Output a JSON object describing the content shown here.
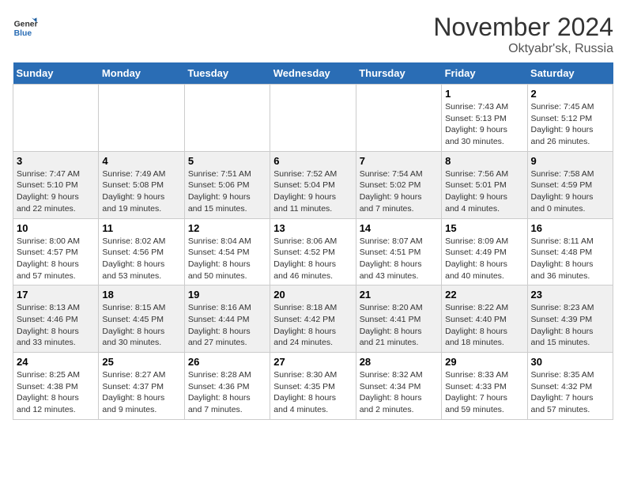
{
  "header": {
    "logo_general": "General",
    "logo_blue": "Blue",
    "month_title": "November 2024",
    "location": "Oktyabr'sk, Russia"
  },
  "days_of_week": [
    "Sunday",
    "Monday",
    "Tuesday",
    "Wednesday",
    "Thursday",
    "Friday",
    "Saturday"
  ],
  "weeks": [
    [
      {
        "day": "",
        "detail": ""
      },
      {
        "day": "",
        "detail": ""
      },
      {
        "day": "",
        "detail": ""
      },
      {
        "day": "",
        "detail": ""
      },
      {
        "day": "",
        "detail": ""
      },
      {
        "day": "1",
        "detail": "Sunrise: 7:43 AM\nSunset: 5:13 PM\nDaylight: 9 hours\nand 30 minutes."
      },
      {
        "day": "2",
        "detail": "Sunrise: 7:45 AM\nSunset: 5:12 PM\nDaylight: 9 hours\nand 26 minutes."
      }
    ],
    [
      {
        "day": "3",
        "detail": "Sunrise: 7:47 AM\nSunset: 5:10 PM\nDaylight: 9 hours\nand 22 minutes."
      },
      {
        "day": "4",
        "detail": "Sunrise: 7:49 AM\nSunset: 5:08 PM\nDaylight: 9 hours\nand 19 minutes."
      },
      {
        "day": "5",
        "detail": "Sunrise: 7:51 AM\nSunset: 5:06 PM\nDaylight: 9 hours\nand 15 minutes."
      },
      {
        "day": "6",
        "detail": "Sunrise: 7:52 AM\nSunset: 5:04 PM\nDaylight: 9 hours\nand 11 minutes."
      },
      {
        "day": "7",
        "detail": "Sunrise: 7:54 AM\nSunset: 5:02 PM\nDaylight: 9 hours\nand 7 minutes."
      },
      {
        "day": "8",
        "detail": "Sunrise: 7:56 AM\nSunset: 5:01 PM\nDaylight: 9 hours\nand 4 minutes."
      },
      {
        "day": "9",
        "detail": "Sunrise: 7:58 AM\nSunset: 4:59 PM\nDaylight: 9 hours\nand 0 minutes."
      }
    ],
    [
      {
        "day": "10",
        "detail": "Sunrise: 8:00 AM\nSunset: 4:57 PM\nDaylight: 8 hours\nand 57 minutes."
      },
      {
        "day": "11",
        "detail": "Sunrise: 8:02 AM\nSunset: 4:56 PM\nDaylight: 8 hours\nand 53 minutes."
      },
      {
        "day": "12",
        "detail": "Sunrise: 8:04 AM\nSunset: 4:54 PM\nDaylight: 8 hours\nand 50 minutes."
      },
      {
        "day": "13",
        "detail": "Sunrise: 8:06 AM\nSunset: 4:52 PM\nDaylight: 8 hours\nand 46 minutes."
      },
      {
        "day": "14",
        "detail": "Sunrise: 8:07 AM\nSunset: 4:51 PM\nDaylight: 8 hours\nand 43 minutes."
      },
      {
        "day": "15",
        "detail": "Sunrise: 8:09 AM\nSunset: 4:49 PM\nDaylight: 8 hours\nand 40 minutes."
      },
      {
        "day": "16",
        "detail": "Sunrise: 8:11 AM\nSunset: 4:48 PM\nDaylight: 8 hours\nand 36 minutes."
      }
    ],
    [
      {
        "day": "17",
        "detail": "Sunrise: 8:13 AM\nSunset: 4:46 PM\nDaylight: 8 hours\nand 33 minutes."
      },
      {
        "day": "18",
        "detail": "Sunrise: 8:15 AM\nSunset: 4:45 PM\nDaylight: 8 hours\nand 30 minutes."
      },
      {
        "day": "19",
        "detail": "Sunrise: 8:16 AM\nSunset: 4:44 PM\nDaylight: 8 hours\nand 27 minutes."
      },
      {
        "day": "20",
        "detail": "Sunrise: 8:18 AM\nSunset: 4:42 PM\nDaylight: 8 hours\nand 24 minutes."
      },
      {
        "day": "21",
        "detail": "Sunrise: 8:20 AM\nSunset: 4:41 PM\nDaylight: 8 hours\nand 21 minutes."
      },
      {
        "day": "22",
        "detail": "Sunrise: 8:22 AM\nSunset: 4:40 PM\nDaylight: 8 hours\nand 18 minutes."
      },
      {
        "day": "23",
        "detail": "Sunrise: 8:23 AM\nSunset: 4:39 PM\nDaylight: 8 hours\nand 15 minutes."
      }
    ],
    [
      {
        "day": "24",
        "detail": "Sunrise: 8:25 AM\nSunset: 4:38 PM\nDaylight: 8 hours\nand 12 minutes."
      },
      {
        "day": "25",
        "detail": "Sunrise: 8:27 AM\nSunset: 4:37 PM\nDaylight: 8 hours\nand 9 minutes."
      },
      {
        "day": "26",
        "detail": "Sunrise: 8:28 AM\nSunset: 4:36 PM\nDaylight: 8 hours\nand 7 minutes."
      },
      {
        "day": "27",
        "detail": "Sunrise: 8:30 AM\nSunset: 4:35 PM\nDaylight: 8 hours\nand 4 minutes."
      },
      {
        "day": "28",
        "detail": "Sunrise: 8:32 AM\nSunset: 4:34 PM\nDaylight: 8 hours\nand 2 minutes."
      },
      {
        "day": "29",
        "detail": "Sunrise: 8:33 AM\nSunset: 4:33 PM\nDaylight: 7 hours\nand 59 minutes."
      },
      {
        "day": "30",
        "detail": "Sunrise: 8:35 AM\nSunset: 4:32 PM\nDaylight: 7 hours\nand 57 minutes."
      }
    ]
  ]
}
